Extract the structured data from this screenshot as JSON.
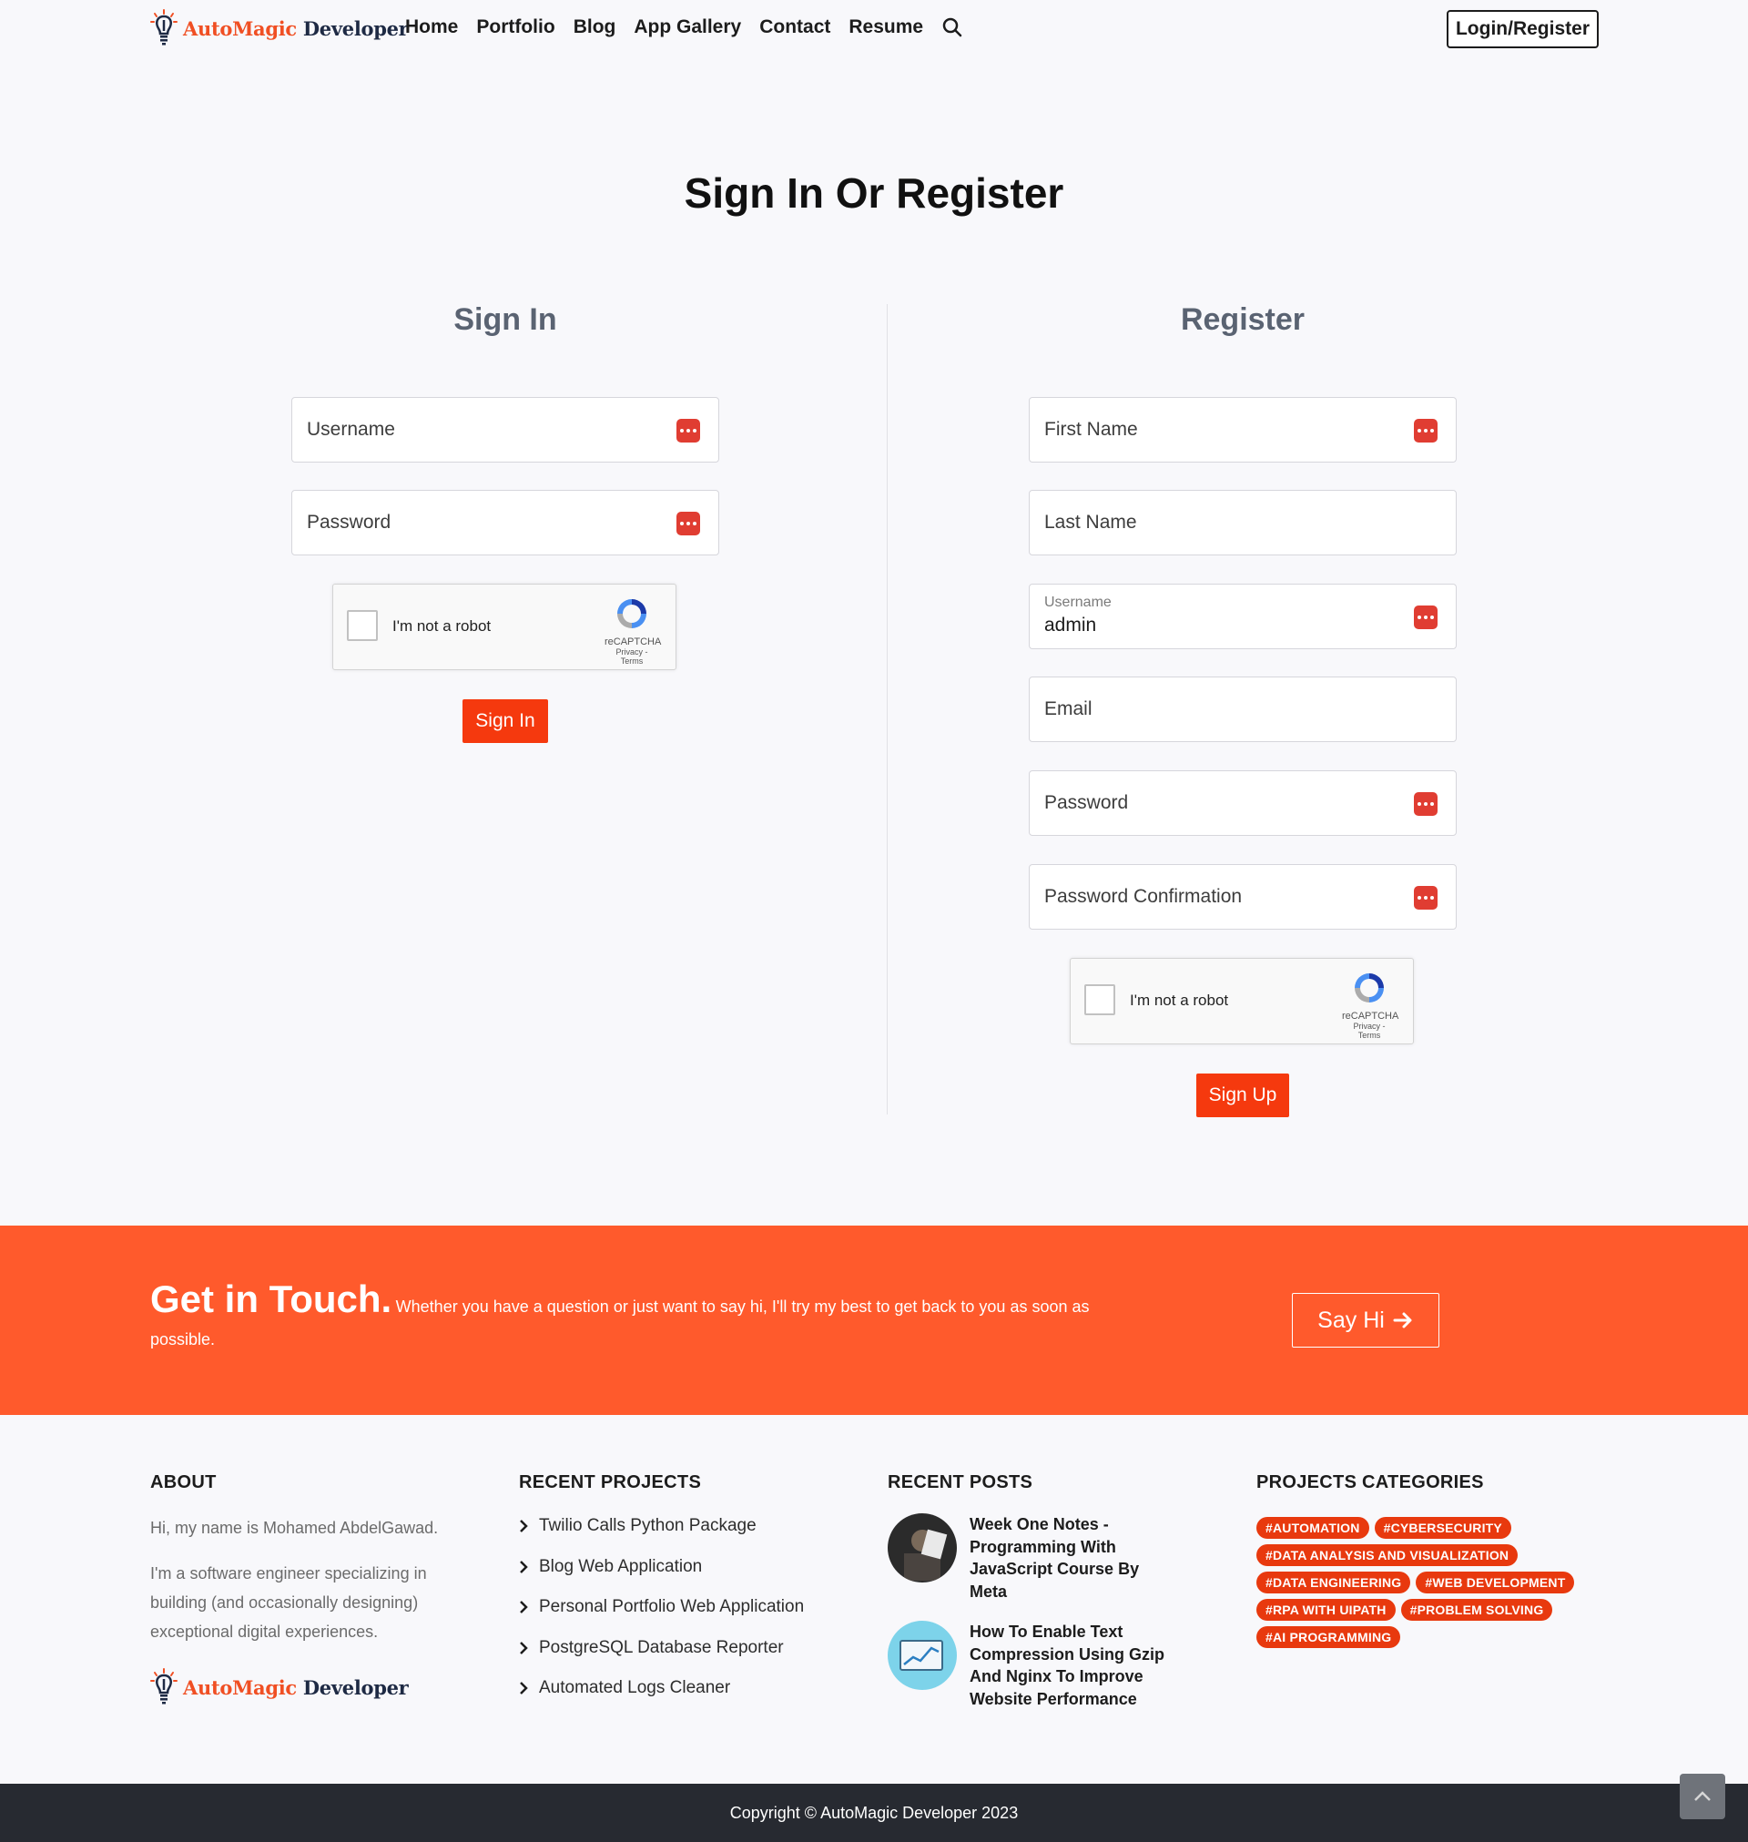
{
  "brand": {
    "part1": "AutoMagic",
    "part2": "Developer"
  },
  "colors": {
    "accent": "#f5390e",
    "cta_bg": "#ff5a2c",
    "footer_dark": "#272a31",
    "tag": "#e8390e"
  },
  "nav": {
    "links": [
      "Home",
      "Portfolio",
      "Blog",
      "App Gallery",
      "Contact",
      "Resume"
    ],
    "login_label": "Login/Register"
  },
  "page_title": "Sign In Or Register",
  "signin": {
    "title": "Sign In",
    "username_placeholder": "Username",
    "password_placeholder": "Password",
    "button": "Sign In"
  },
  "register": {
    "title": "Register",
    "first_name_placeholder": "First Name",
    "last_name_placeholder": "Last Name",
    "username_label": "Username",
    "username_value": "admin",
    "email_placeholder": "Email",
    "password_placeholder": "Password",
    "password_confirm_placeholder": "Password Confirmation",
    "button": "Sign Up"
  },
  "recaptcha": {
    "label": "I'm not a robot",
    "brand": "reCAPTCHA",
    "terms": "Privacy - Terms"
  },
  "cta": {
    "heading": "Get in Touch.",
    "text": "Whether you have a question or just want to say hi, I'll try my best to get back to you as soon as possible.",
    "button": "Say Hi"
  },
  "footer": {
    "about": {
      "heading": "ABOUT",
      "p1": "Hi, my name is Mohamed AbdelGawad.",
      "p2": "I'm a software engineer specializing in building (and occasionally designing) exceptional digital experiences."
    },
    "projects": {
      "heading": "RECENT PROJECTS",
      "items": [
        "Twilio Calls Python Package",
        "Blog Web Application",
        "Personal Portfolio Web Application",
        "PostgreSQL Database Reporter",
        "Automated Logs Cleaner"
      ]
    },
    "posts": {
      "heading": "RECENT POSTS",
      "items": [
        {
          "title": "Week One Notes - Programming With JavaScript Course By Meta"
        },
        {
          "title": "How To Enable Text Compression Using Gzip And Nginx To Improve Website Performance"
        }
      ]
    },
    "categories": {
      "heading": "PROJECTS CATEGORIES",
      "tags": [
        "#AUTOMATION",
        "#CYBERSECURITY",
        "#DATA ANALYSIS AND VISUALIZATION",
        "#DATA ENGINEERING",
        "#WEB DEVELOPMENT",
        "#RPA WITH UIPATH",
        "#PROBLEM SOLVING",
        "#AI PROGRAMMING"
      ]
    },
    "copyright": "Copyright © AutoMagic Developer 2023"
  }
}
